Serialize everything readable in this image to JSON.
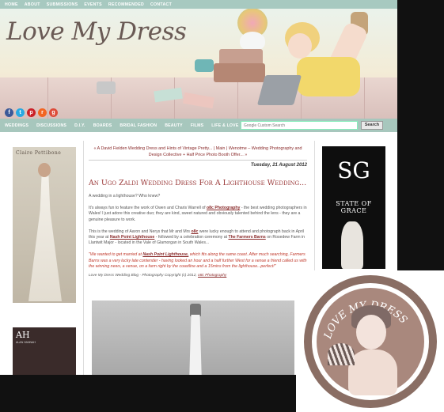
{
  "topnav": [
    "HOME",
    "ABOUT",
    "SUBMISSIONS",
    "EVENTS",
    "RECOMMENDED",
    "CONTACT"
  ],
  "logo": "Love My Dress",
  "social": [
    {
      "icon": "facebook-icon",
      "glyph": "f",
      "color": "#3b5998"
    },
    {
      "icon": "twitter-icon",
      "glyph": "t",
      "color": "#29a9e1"
    },
    {
      "icon": "pinterest-icon",
      "glyph": "p",
      "color": "#cb2027"
    },
    {
      "icon": "rss-icon",
      "glyph": "r",
      "color": "#f26522"
    },
    {
      "icon": "googleplus-icon",
      "glyph": "g",
      "color": "#dd4b39"
    }
  ],
  "mainnav": [
    "WEDDINGS",
    "DISCUSSIONS",
    "D.I.Y.",
    "BOARDS",
    "BRIDAL FASHION",
    "BEAUTY",
    "FILMS",
    "LIFE & LOVE"
  ],
  "search": {
    "placeholder": "Google Custom Search",
    "button": "Search"
  },
  "sidebar_left": {
    "ad1_title": "Claire Pettibone",
    "ad2_title": "AH",
    "ad2_sub": "ALAN HANNAH"
  },
  "sidebar_right": {
    "logo": "SG",
    "title": "STATE OF GRACE"
  },
  "post": {
    "prev_link": "« A David Fielden Wedding Dress and Hints of Vintage Pretty...",
    "sep1": "|",
    "main_link": "Main",
    "sep2": "|",
    "next_link": "Wenotme – Wedding Photography and Design Collective + Half Price Photo Booth Offer... »",
    "date": "Tuesday, 21 August 2012",
    "title": "An Ugo Zaldi Wedding Dress For A Lighthouse Wedding...",
    "p1": "A wedding in a lighthouse? Who knew?",
    "p2a": "It's always fun to feature the work of Owen and Charis Warrell of ",
    "p2link": "o8c Photography",
    "p2b": " - the best wedding photographers in Wales! I just adore this creative duo; they are kind, sweet natured and obviously talented behind the lens - they are a genuine pleasure to work.",
    "p3a": "This is the wedding of Aaron and Nerys that Mr and Mrs ",
    "p3link1": "o8c",
    "p3b": " were lucky enough to attend and photograph back in April this year at ",
    "p3link2": "Nash Point Lighthouse",
    "p3c": " - followed by a celebration ceremony at ",
    "p3link3": "The Farmers Barns",
    "p3d": " on Rosedew Farm in Llantwit Major - located in the Vale of Glamorgan in South Wales...",
    "quote_a": "\"We wanted to get married at ",
    "quote_link": "Nash Point Lighthouse,",
    "quote_b": " which fits along the same coast. After much searching, Farmers Barns was a very lucky late contender - having looked an hour and a half further West for a venue a friend called us with the winning news, a venue, on a farm right by the coastline and a 15mins from the lighthouse...perfect!\"",
    "credit_a": "Love My Dress Wedding Blog - Photography Copyright (c) 2012, ",
    "credit_link": "o8c Photography"
  },
  "badge": {
    "text": "LOVE MY DRESS"
  }
}
